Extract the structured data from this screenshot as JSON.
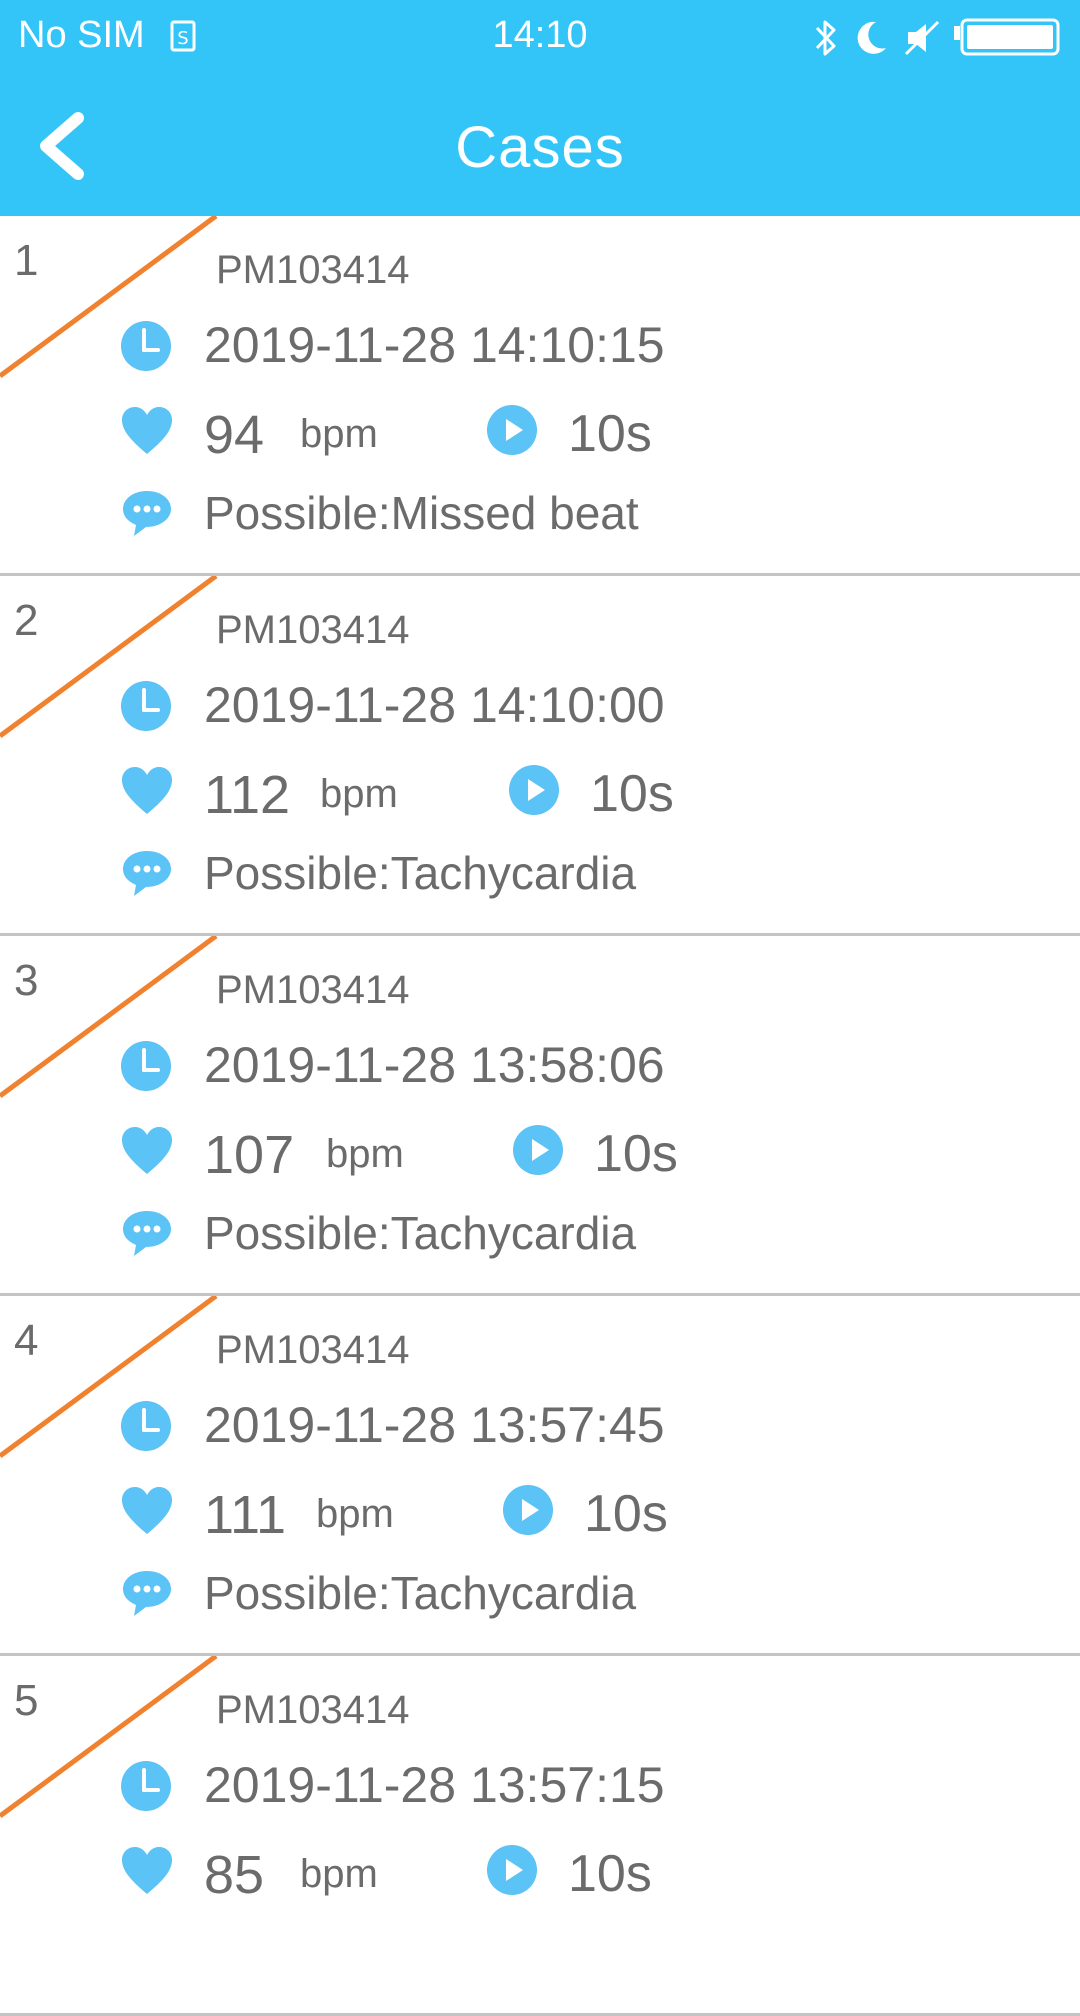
{
  "status_bar": {
    "carrier": "No SIM",
    "time": "14:10"
  },
  "header": {
    "title": "Cases"
  },
  "colors": {
    "accent": "#33c5f7",
    "icon_blue": "#5bc3f5",
    "flag_orange": "#f0812e",
    "text": "#6b6b6b"
  },
  "icons": [
    "sim-card-icon",
    "bluetooth-icon",
    "moon-icon",
    "mute-icon",
    "battery-icon",
    "back-chevron-icon",
    "clock-icon",
    "heart-icon",
    "play-icon",
    "chat-bubble-icon"
  ],
  "cases": [
    {
      "index": "1",
      "device": "PM103414",
      "datetime": "2019-11-28 14:10:15",
      "bpm": "94",
      "unit": "bpm",
      "duration": "10s",
      "diagnosis": "Possible:Missed beat"
    },
    {
      "index": "2",
      "device": "PM103414",
      "datetime": "2019-11-28 14:10:00",
      "bpm": "112",
      "unit": "bpm",
      "duration": "10s",
      "diagnosis": "Possible:Tachycardia"
    },
    {
      "index": "3",
      "device": "PM103414",
      "datetime": "2019-11-28 13:58:06",
      "bpm": "107",
      "unit": "bpm",
      "duration": "10s",
      "diagnosis": "Possible:Tachycardia"
    },
    {
      "index": "4",
      "device": "PM103414",
      "datetime": "2019-11-28 13:57:45",
      "bpm": "111",
      "unit": "bpm",
      "duration": "10s",
      "diagnosis": "Possible:Tachycardia"
    },
    {
      "index": "5",
      "device": "PM103414",
      "datetime": "2019-11-28 13:57:15",
      "bpm": "85",
      "unit": "bpm",
      "duration": "10s",
      "diagnosis": ""
    }
  ]
}
